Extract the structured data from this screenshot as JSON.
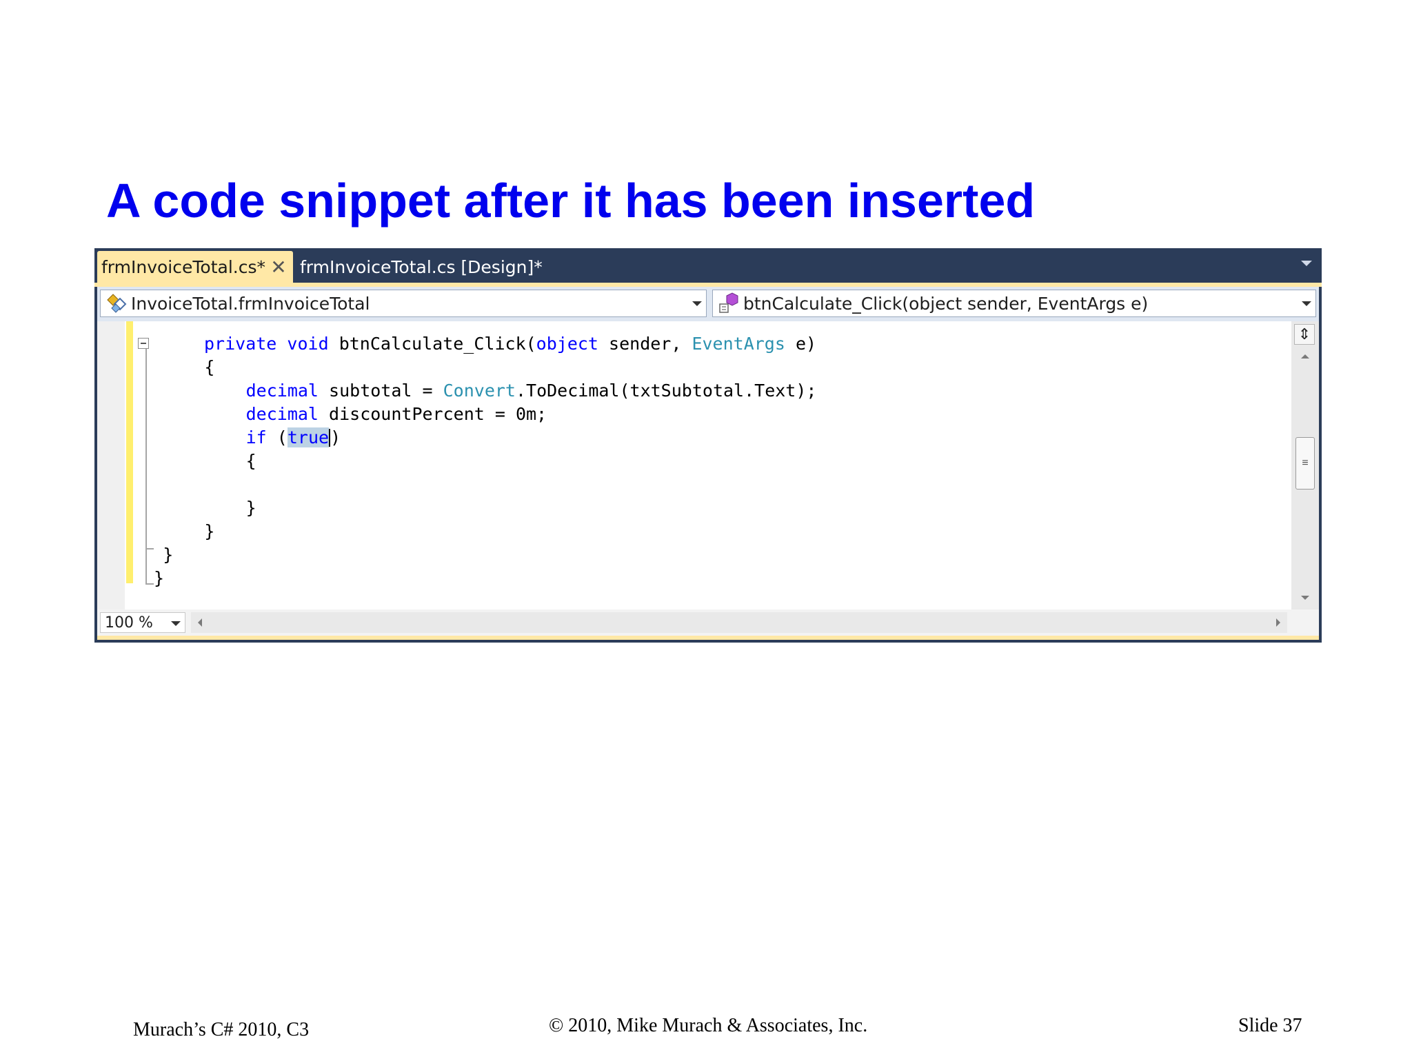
{
  "slide": {
    "title": "A code snippet after it has been inserted"
  },
  "ide": {
    "tabs": [
      {
        "label": "frmInvoiceTotal.cs*",
        "active": true
      },
      {
        "label": "frmInvoiceTotal.cs [Design]*",
        "active": false
      }
    ],
    "close_icon": "close-icon",
    "class_combo": {
      "value": "InvoiceTotal.frmInvoiceTotal",
      "icon": "class-icon"
    },
    "member_combo": {
      "value": "btnCalculate_Click(object sender, EventArgs e)",
      "icon": "method-icon"
    },
    "code": {
      "l1": {
        "indent": "        ",
        "kw1": "private",
        "sp1": " ",
        "kw2": "void",
        "name": " btnCalculate_Click(",
        "kw3": "object",
        "mid": " sender, ",
        "type": "EventArgs",
        "end": " e)"
      },
      "l2": {
        "text": "        {"
      },
      "l3": {
        "indent": "            ",
        "kw": "decimal",
        "mid": " subtotal = ",
        "type": "Convert",
        "end": ".ToDecimal(txtSubtotal.Text);"
      },
      "l4": {
        "indent": "            ",
        "kw": "decimal",
        "end": " discountPercent = 0m;"
      },
      "l5": {
        "indent": "            ",
        "kw": "if",
        "open": " (",
        "sel": "true",
        "close": ")"
      },
      "l6": {
        "text": "            {"
      },
      "l8": {
        "text": "            }"
      },
      "l9": {
        "text": "        }"
      },
      "l10": {
        "text": "    }"
      },
      "l11": {
        "text": "}"
      }
    },
    "zoom": "100 %",
    "colors": {
      "keyword": "#0000ff",
      "type": "#2b91af",
      "selection": "#bcd2e4",
      "tab_active": "#ffe8a6",
      "frame": "#2b3c59"
    }
  },
  "footer": {
    "left": "Murach’s C# 2010, C3",
    "center": "© 2010, Mike Murach & Associates, Inc.",
    "right": "Slide 37"
  }
}
